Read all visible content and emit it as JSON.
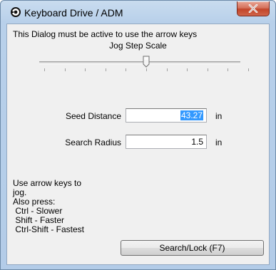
{
  "window": {
    "title": "Keyboard Drive / ADM",
    "close_icon": "close-icon",
    "app_icon": "app-icon"
  },
  "dialog": {
    "instruction": "This Dialog must be active to use the arrow keys",
    "slider": {
      "label": "Jog Step Scale",
      "level": 0.5,
      "tick_count": 11
    },
    "fields": {
      "seed_distance": {
        "label": "Seed Distance",
        "value": "43.27",
        "unit": "in",
        "selected": true
      },
      "search_radius": {
        "label": "Search Radius",
        "value": "1.5",
        "unit": "in",
        "selected": false
      }
    },
    "help_lines": [
      "Use arrow keys to",
      "jog.",
      "Also press:",
      " Ctrl - Slower",
      " Shift - Faster",
      " Ctrl-Shift - Fastest"
    ],
    "search_button": "Search/Lock (F7)"
  }
}
